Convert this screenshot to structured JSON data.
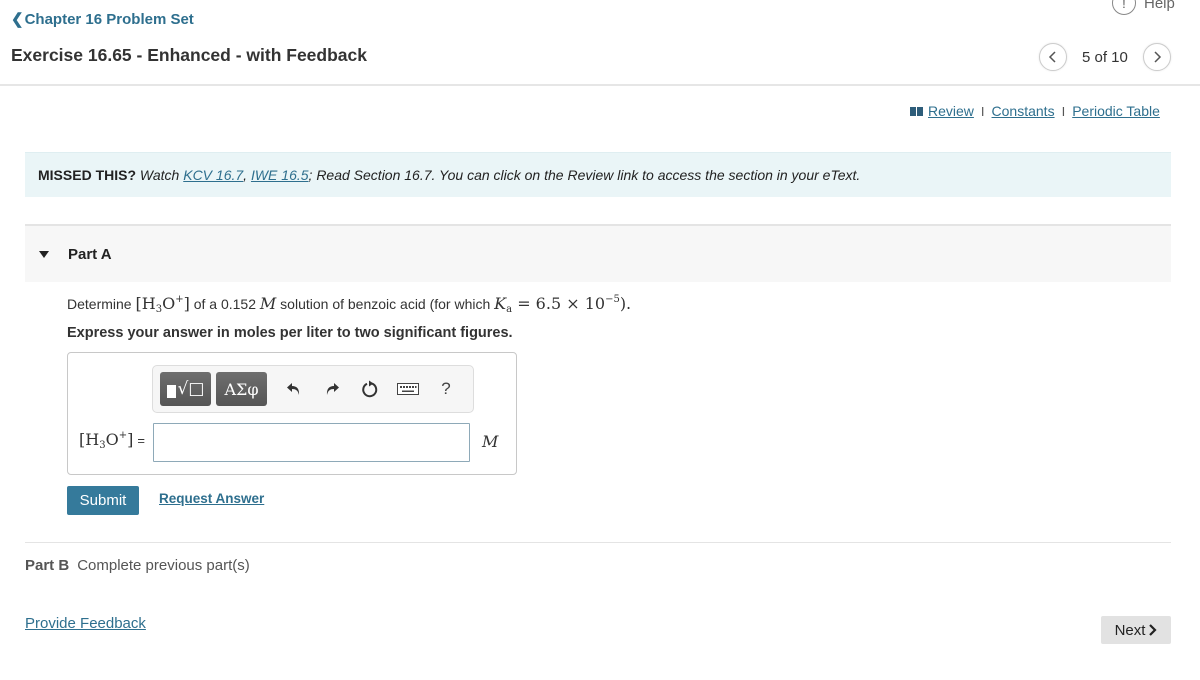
{
  "header": {
    "help_label": "Help",
    "back_link": "Chapter 16 Problem Set",
    "exercise_title": "Exercise 16.65 - Enhanced - with Feedback",
    "pager": {
      "current": 5,
      "total": 10,
      "text": "5 of 10",
      "prev_icon": "chevron-left-icon",
      "next_icon": "chevron-right-icon"
    }
  },
  "resources": {
    "links": [
      "Review",
      "Constants",
      "Periodic Table"
    ],
    "separator": "I"
  },
  "missed": {
    "lead": "MISSED THIS?",
    "watch": "Watch",
    "link1": "KCV 16.7",
    "comma": ",",
    "link2": "IWE 16.5",
    "rest": "; Read Section 16.7. You can click on the Review link to access the section in your eText."
  },
  "partA": {
    "title": "Part A",
    "question": {
      "pre": "Determine",
      "species": "[H3O+]",
      "mid1": "of a 0.152",
      "unit": "M",
      "mid2": "solution of benzoic acid (for which",
      "ka_symbol": "Ka",
      "ka_value": "= 6.5 × 10",
      "ka_exponent": "−5",
      "end": ")."
    },
    "instruction": "Express your answer in moles per liter to two significant figures.",
    "toolbar": {
      "templates_label": "√□",
      "greek_label": "ΑΣφ",
      "help_label": "?",
      "icons": [
        "undo-icon",
        "redo-icon",
        "reset-icon",
        "keyboard-icon",
        "help-icon"
      ]
    },
    "answer": {
      "label": "[H3O+] =",
      "equals": "=",
      "value": "",
      "placeholder": "",
      "unit": "M"
    },
    "submit_label": "Submit",
    "request_answer_label": "Request Answer"
  },
  "partB": {
    "title": "Part B",
    "status": "Complete previous part(s)"
  },
  "footer": {
    "provide_feedback": "Provide Feedback",
    "next_label": "Next"
  }
}
